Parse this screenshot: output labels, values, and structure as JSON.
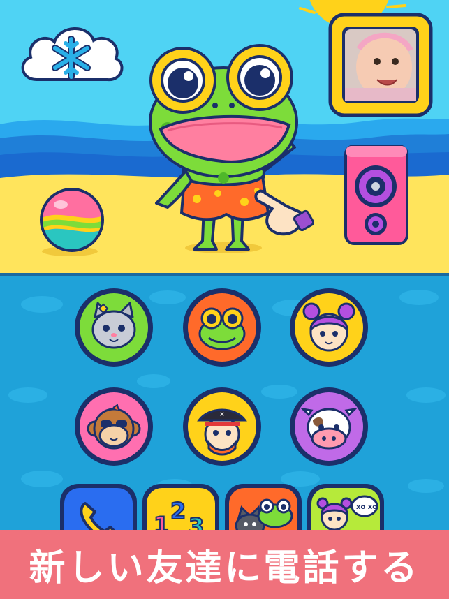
{
  "scene": {
    "snow_button_icon": "snowflake-icon",
    "photo_button_icon": "baby-photo",
    "character": "frog",
    "ball_icon": "beach-ball",
    "speaker_icon": "speaker-icon",
    "hand_icon": "tap-hand-icon"
  },
  "contacts": [
    {
      "id": "cat",
      "bg": "#7ddc3a"
    },
    {
      "id": "frog",
      "bg": "#ff6a2a"
    },
    {
      "id": "girl",
      "bg": "#ffd21a"
    },
    {
      "id": "monkey",
      "bg": "#ff6fb0"
    },
    {
      "id": "pirate",
      "bg": "#ffd21a"
    },
    {
      "id": "cow",
      "bg": "#c06ae8"
    }
  ],
  "tabs": [
    {
      "id": "phone",
      "icon": "phone-icon",
      "bg": "#2a6df0"
    },
    {
      "id": "numbers",
      "icon": "numbers-icon",
      "bg": "#ffd21a"
    },
    {
      "id": "animals",
      "icon": "animals-icon",
      "bg": "#ff6a2a"
    },
    {
      "id": "friends",
      "icon": "friends-icon",
      "bg": "#b6ea3a",
      "badge": "xo xo"
    }
  ],
  "banner": {
    "text": "新しい友達に電話する"
  },
  "colors": {
    "sky": "#4fd3f4",
    "sand": "#ffe45c",
    "sea": "#1f8fe0",
    "panel": "#1fa2d9",
    "banner": "#f0717c",
    "outline": "#1b2f6a"
  }
}
